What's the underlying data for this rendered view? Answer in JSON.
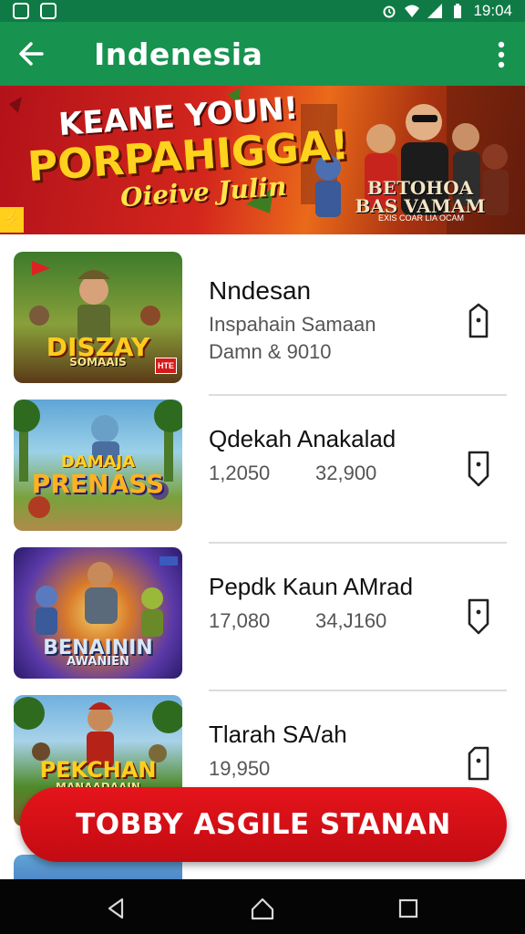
{
  "status_bar": {
    "time": "19:04",
    "left_icons": [
      "notification-icon",
      "photo-icon"
    ],
    "right_icons": [
      "alarm-icon",
      "wifi-icon",
      "signal-icon",
      "battery-icon"
    ]
  },
  "app_bar": {
    "title": "Indenesia",
    "back_icon": "arrow-left-icon",
    "menu_icon": "more-vert-icon"
  },
  "banner": {
    "line1": "KEANE YOUN!",
    "line2": "PORPAHIGGA!",
    "line3": "Oieive Julin",
    "logo_title": "BETOHOA BAS VAMAM",
    "logo_sub": "EXIS COAR LIA OCAM",
    "corner_badge": "⚡"
  },
  "games": [
    {
      "title": "Nndesan",
      "subtitle": "Inspahain Samaan",
      "subtitle2": "Damn & 9010",
      "thumb_text": "DISZAY",
      "thumb_sub": "SOMAAIS",
      "thumb_badge": "HTE",
      "action_icon": "bookmark-icon"
    },
    {
      "title": "Qdekah Anakalad",
      "value1": "1,2050",
      "value2": "32,900",
      "thumb_text": "DAMAJA",
      "thumb_sub": "PRENASS",
      "action_icon": "bookmark-icon"
    },
    {
      "title": "Pepdk Kaun AMrad",
      "value1": "17,080",
      "value2": "34,J160",
      "thumb_text": "BENAININ",
      "thumb_sub": "AWANIEN",
      "action_icon": "bookmark-icon"
    },
    {
      "title": "Tlarah SA/ah",
      "value1": "19,950",
      "thumb_text": "PEKCHAN",
      "thumb_sub": "MANAADAAIN",
      "action_icon": "bookmark-icon"
    }
  ],
  "fab": {
    "label": "TOBBY ASGILE STANAN"
  },
  "nav_bar": {
    "icons": [
      "nav-back-icon",
      "nav-home-icon",
      "nav-recents-icon"
    ]
  },
  "colors": {
    "primary": "#17924f",
    "status": "#0f7a45",
    "accent": "#e5141b"
  }
}
